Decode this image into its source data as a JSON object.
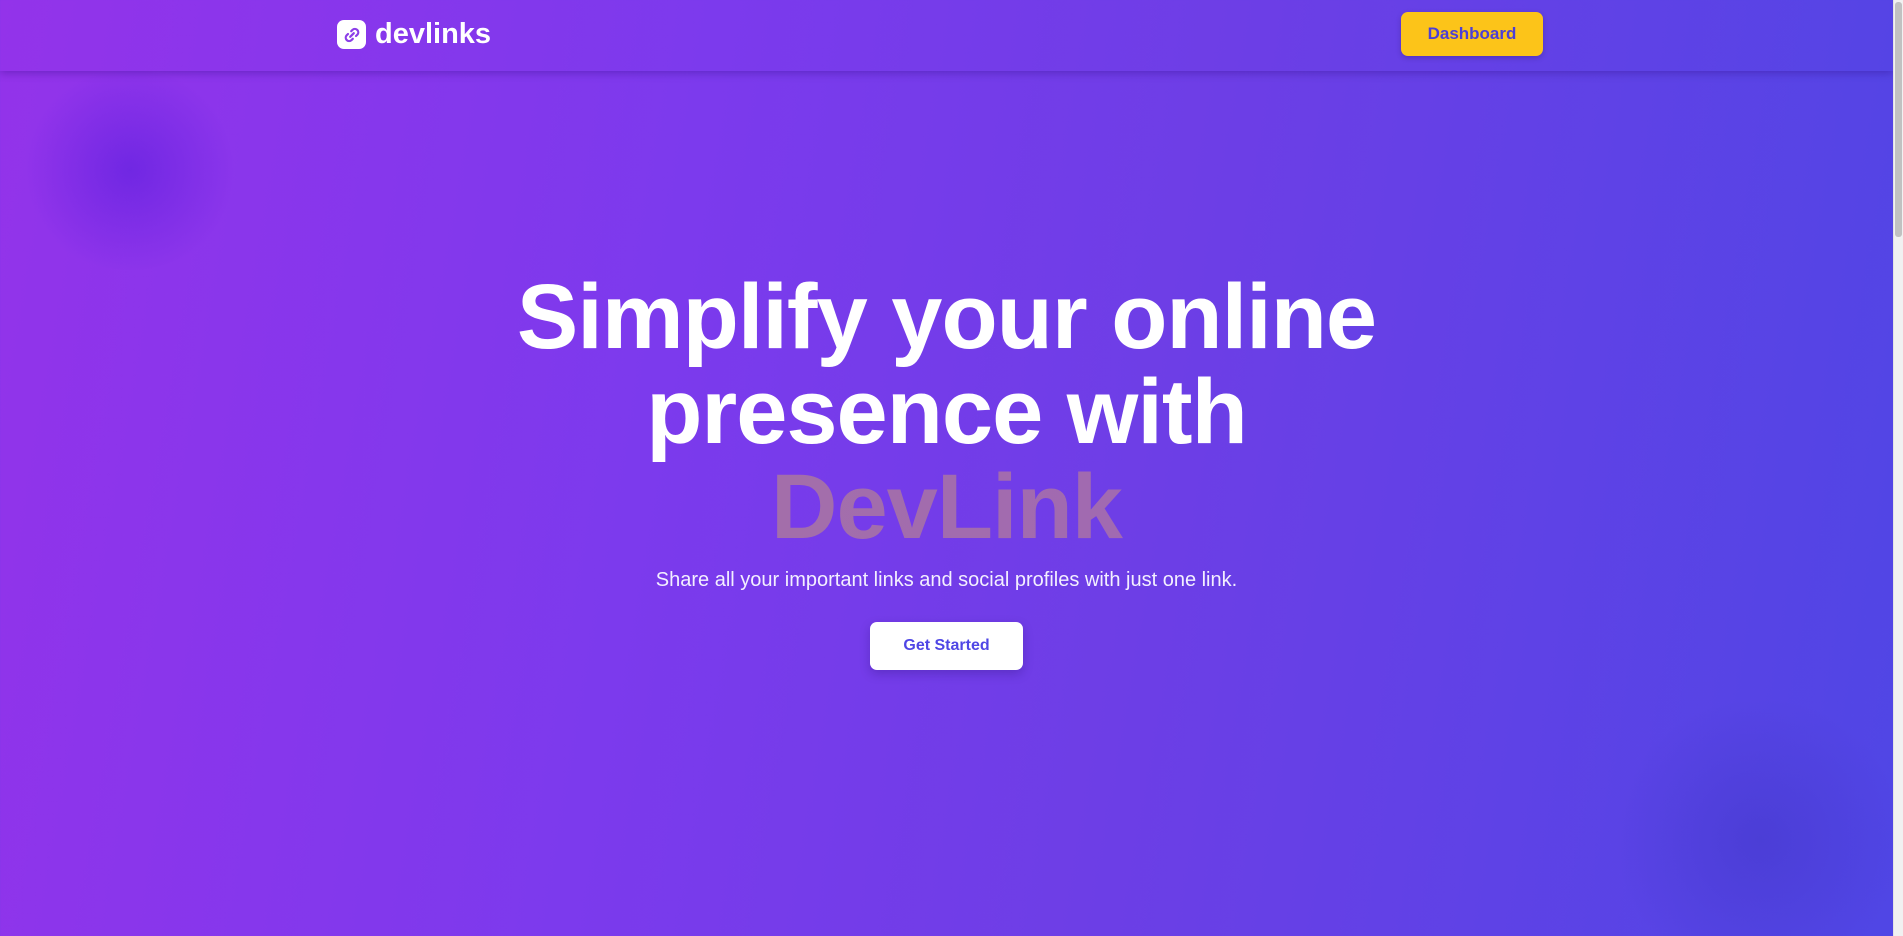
{
  "header": {
    "brand_name": "devlinks",
    "brand_icon": "link-icon",
    "dashboard_label": "Dashboard"
  },
  "hero": {
    "line1": "Simplify your online",
    "line2": "presence with",
    "accent": "DevLink",
    "subtitle": "Share all your important links and social profiles with just one link.",
    "cta_label": "Get Started"
  },
  "colors": {
    "gradient_start": "#9333ea",
    "gradient_end": "#4f46e5",
    "dashboard_button": "#fcc419",
    "button_text": "#4f46e5"
  }
}
